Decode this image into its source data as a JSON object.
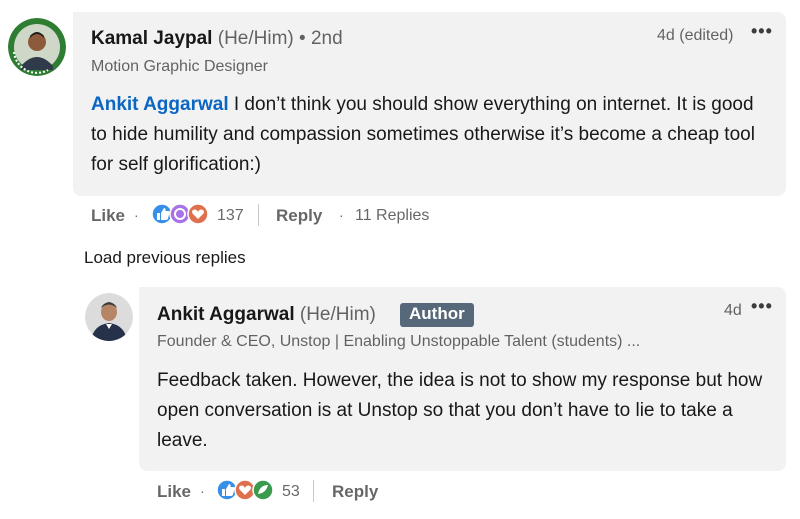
{
  "comment": {
    "author_name": "Kamal Jaypal",
    "pronouns": "(He/Him)",
    "degree": "• 2nd",
    "headline": "Motion Graphic Designer",
    "timestamp": "4d (edited)",
    "mention": "Ankit Aggarwal",
    "text": " I don’t think you should show everything on internet. It is good to hide humility and compassion sometimes otherwise it’s become a cheap tool for self glorification:)",
    "like_label": "Like",
    "reaction_count": "137",
    "reply_label": "Reply",
    "replies_count": "11 Replies",
    "reactions": [
      "like-icon",
      "support-icon",
      "love-icon"
    ],
    "avatar_ring_text": "#OPENTOWORK"
  },
  "load_previous": "Load previous replies",
  "reply": {
    "author_name": "Ankit Aggarwal",
    "pronouns": "(He/Him)",
    "badge": "Author",
    "headline": "Founder & CEO, Unstop | Enabling Unstoppable Talent (students) ...",
    "timestamp": "4d",
    "text": "Feedback taken. However, the idea is not to show my response but how open conversation is at Unstop so that you don’t have to lie to take a leave.",
    "like_label": "Like",
    "reaction_count": "53",
    "reply_label": "Reply",
    "reactions": [
      "like-icon",
      "love-icon",
      "insightful-icon"
    ]
  },
  "colors": {
    "link": "#0a66c2",
    "bubble": "#f2f2f2",
    "badge": "#56687a",
    "open_to_work": "#2e7d32",
    "like": "#378fe9",
    "love": "#df704d",
    "support": "#a872e8",
    "insightful": "#3a9b4f"
  }
}
